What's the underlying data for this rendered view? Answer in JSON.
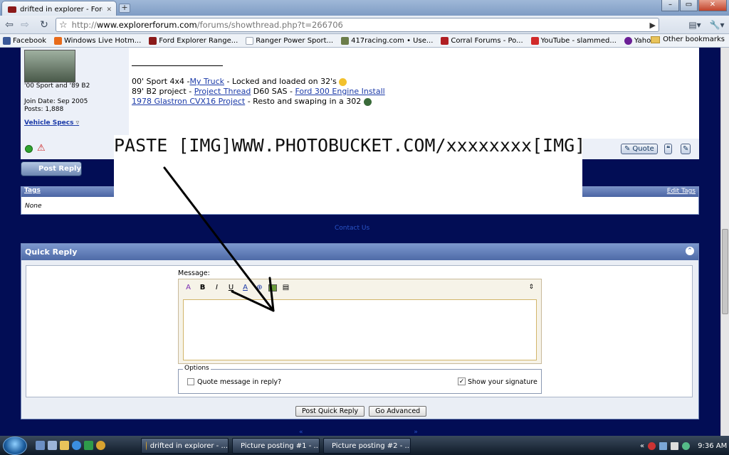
{
  "browser": {
    "tab_title": "drifted in explorer - Ford ...",
    "new_tab": "+",
    "window_controls": [
      "–",
      "▭",
      "✕"
    ],
    "url_prefix": "http://",
    "url_host": "www.explorerforum.com",
    "url_path": "/forums/showthread.php?t=266706"
  },
  "bookmarks": {
    "items": [
      {
        "label": "Facebook",
        "color": "#3b5998"
      },
      {
        "label": "Windows Live Hotm...",
        "color": "#e86b1a"
      },
      {
        "label": "Ford Explorer Range...",
        "color": "#8b1a1a"
      },
      {
        "label": "Ranger Power Sport...",
        "color": "#9aa4b2"
      },
      {
        "label": "417racing.com • Use...",
        "color": "#6c7d4a"
      },
      {
        "label": "Corral Forums - Po...",
        "color": "#b01e23"
      },
      {
        "label": "YouTube - slammed...",
        "color": "#d12a2a"
      },
      {
        "label": "Yahoo!",
        "color": "#6b1f96"
      }
    ],
    "other": "Other bookmarks"
  },
  "post": {
    "user_line1": "'00 Sport and '89 B2",
    "join_date": "Join Date: Sep 2005",
    "posts": "Posts: 1,888",
    "vehicle_specs": "Vehicle Specs",
    "sig": {
      "line1_pre": "00' Sport 4x4 -",
      "line1_link": "My Truck",
      "line1_post": " - Locked and loaded on 32's",
      "line2_pre": "89' B2 project - ",
      "line2_link1": "Project Thread",
      "line2_mid": " D60 SAS - ",
      "line2_link2": "Ford 300 Engine Install",
      "line3_link": "1978 Glastron CVX16 Project",
      "line3_post": " - Resto and swaping in a 302"
    },
    "quote_button": "Quote"
  },
  "post_reply_button": "Post Reply",
  "tags": {
    "title": "Tags",
    "edit": "Edit Tags",
    "value": "None"
  },
  "overlay_text": "PASTE [IMG]WWW.PHOTOBUCKET.COM/xxxxxxxx[IMG]",
  "contact_link": "Contact Us",
  "quick_reply": {
    "title": "Quick Reply",
    "message_label": "Message:",
    "options_legend": "Options",
    "quote_option": "Quote message in reply?",
    "quote_checked": false,
    "signature_option": "Show your signature",
    "signature_checked": true,
    "post_button": "Post Quick Reply",
    "advanced_button": "Go Advanced"
  },
  "bottom_nav": {
    "prev": "«",
    "next": "»"
  },
  "taskbar": {
    "tasks": [
      "drifted in explorer - ...",
      "Picture posting #1 - ...",
      "Picture posting #2 - ..."
    ],
    "clock": "9:36 AM"
  }
}
